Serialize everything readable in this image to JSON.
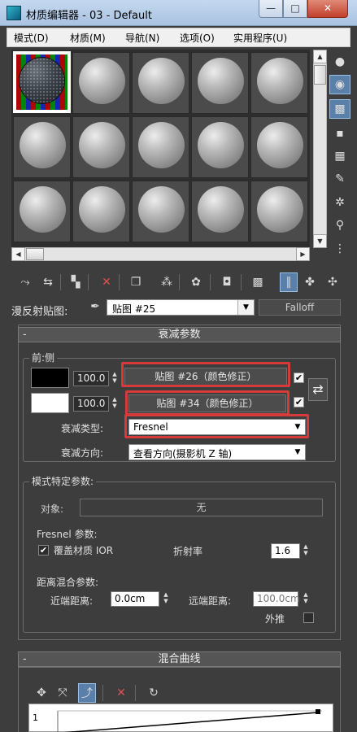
{
  "window": {
    "title": "材质编辑器 - 03 - Default",
    "icon": "app-icon-3dsmax",
    "controls": {
      "min": "—",
      "max": "□",
      "close": "✕"
    }
  },
  "menu": [
    "模式(D)",
    "材质(M)",
    "导航(N)",
    "选项(O)",
    "实用程序(U)"
  ],
  "slots": {
    "rows": 3,
    "cols": 5,
    "active_index": 0
  },
  "side_toolbar": [
    {
      "icon": "sample-type-sphere-icon",
      "on": false
    },
    {
      "icon": "backlight-icon",
      "on": true
    },
    {
      "icon": "background-checker-icon",
      "on": true
    },
    {
      "icon": "sample-uv-tiling-icon",
      "on": false
    },
    {
      "icon": "video-color-check-icon",
      "on": false
    },
    {
      "icon": "make-preview-icon",
      "on": false
    },
    {
      "icon": "options-icon",
      "on": false
    },
    {
      "icon": "select-by-material-icon",
      "on": false
    },
    {
      "icon": "material-map-navigator-icon",
      "on": false
    }
  ],
  "bottom_toolbar": [
    {
      "icon": "get-material-icon",
      "on": false
    },
    {
      "icon": "put-material-to-scene-icon",
      "on": false
    },
    {
      "icon": "assign-material-icon",
      "on": false
    },
    {
      "icon": "reset-map-icon",
      "on": false
    },
    {
      "icon": "copy-material-icon",
      "on": false
    },
    {
      "icon": "make-unique-icon",
      "on": false
    },
    {
      "icon": "put-to-library-icon",
      "on": false
    },
    {
      "icon": "material-id-channel-icon",
      "on": false
    },
    {
      "icon": "show-shaded-in-viewport-icon",
      "on": false
    },
    {
      "icon": "show-end-result-icon",
      "on": true
    },
    {
      "icon": "go-to-parent-icon",
      "on": false
    },
    {
      "icon": "go-forward-sibling-icon",
      "on": false
    }
  ],
  "diffuse": {
    "label": "漫反射贴图:",
    "map_name": "贴图 #25",
    "map_type": "Falloff"
  },
  "falloff_params": {
    "title": "衰减参数",
    "collapse": "-",
    "front_side_label": "前:侧",
    "row1": {
      "swatch_color": "#000000",
      "value": "100.0",
      "map": "贴图 #26（颜色修正）",
      "checked": true
    },
    "row2": {
      "swatch_color": "#ffffff",
      "value": "100.0",
      "map": "贴图 #34（颜色修正）",
      "checked": true
    },
    "swap_icon": "swap-colors-icon",
    "falloff_type_label": "衰减类型:",
    "falloff_type_value": "Fresnel",
    "falloff_dir_label": "衰减方向:",
    "falloff_dir_value": "查看方向(摄影机 Z 轴)",
    "highlight_color": "#d63a3a"
  },
  "mode_params": {
    "title": "模式特定参数:",
    "object_label": "对象:",
    "object_value": "无",
    "fresnel_title": "Fresnel 参数:",
    "override_ior_label": "覆盖材质 IOR",
    "override_checked": true,
    "ior_label": "折射率",
    "ior_value": "1.6",
    "distance_title": "距离混合参数:",
    "near_label": "近端距离:",
    "near_value": "0.0cm",
    "far_label": "远端距离:",
    "far_value": "100.0cm",
    "extrapolate_label": "外推"
  },
  "mix_curve": {
    "title": "混合曲线",
    "collapse": "-",
    "tools": [
      "move-icon",
      "scale-point-icon",
      "add-point-icon",
      "delete-point-icon",
      "reset-curves-icon"
    ],
    "curve_axis_label": "1"
  }
}
